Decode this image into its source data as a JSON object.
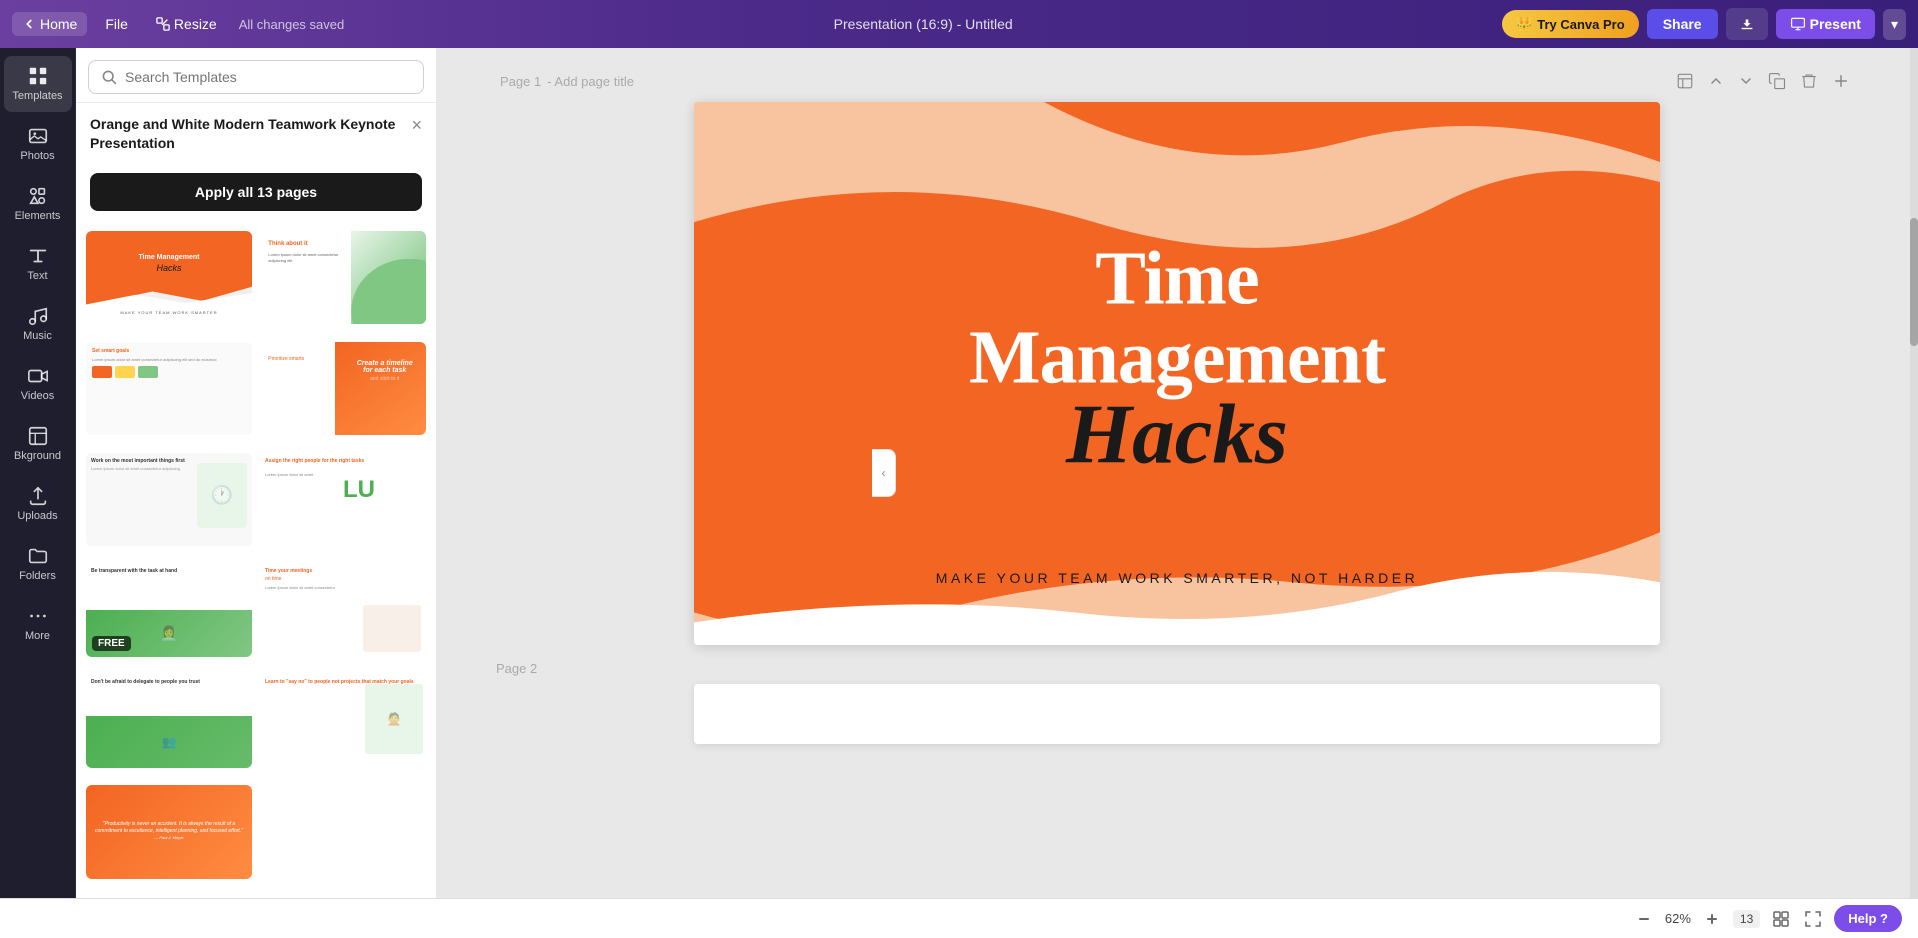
{
  "topbar": {
    "home_label": "Home",
    "file_label": "File",
    "resize_label": "Resize",
    "saved_label": "All changes saved",
    "presentation_title": "Presentation (16:9) - Untitled",
    "canva_pro_label": "Try Canva Pro",
    "share_label": "Share",
    "download_tooltip": "Download",
    "present_label": "Present",
    "present_arrow": "▾"
  },
  "sidebar": {
    "items": [
      {
        "id": "templates",
        "label": "Templates",
        "icon": "grid-icon"
      },
      {
        "id": "photos",
        "label": "Photos",
        "icon": "photo-icon"
      },
      {
        "id": "elements",
        "label": "Elements",
        "icon": "elements-icon"
      },
      {
        "id": "text",
        "label": "Text",
        "icon": "text-icon"
      },
      {
        "id": "music",
        "label": "Music",
        "icon": "music-icon"
      },
      {
        "id": "videos",
        "label": "Videos",
        "icon": "video-icon"
      },
      {
        "id": "background",
        "label": "Bkground",
        "icon": "background-icon"
      },
      {
        "id": "uploads",
        "label": "Uploads",
        "icon": "upload-icon"
      },
      {
        "id": "folders",
        "label": "Folders",
        "icon": "folder-icon"
      },
      {
        "id": "more",
        "label": "More",
        "icon": "more-icon"
      }
    ]
  },
  "templates_panel": {
    "search_placeholder": "Search Templates",
    "template_title": "Orange and White Modern Teamwork Keynote Presentation",
    "apply_button_label": "Apply all 13 pages",
    "close_icon": "×"
  },
  "canvas": {
    "page1_label": "Page 1",
    "page1_add_title": "- Add page title",
    "page2_label": "Page 2",
    "slide": {
      "main_title": "Time Management",
      "script_title": "Hacks",
      "subtitle": "MAKE YOUR TEAM WORK SMARTER, NOT HARDER"
    }
  },
  "bottom_bar": {
    "zoom": "62%",
    "page_count": "13",
    "help_label": "Help ?"
  }
}
